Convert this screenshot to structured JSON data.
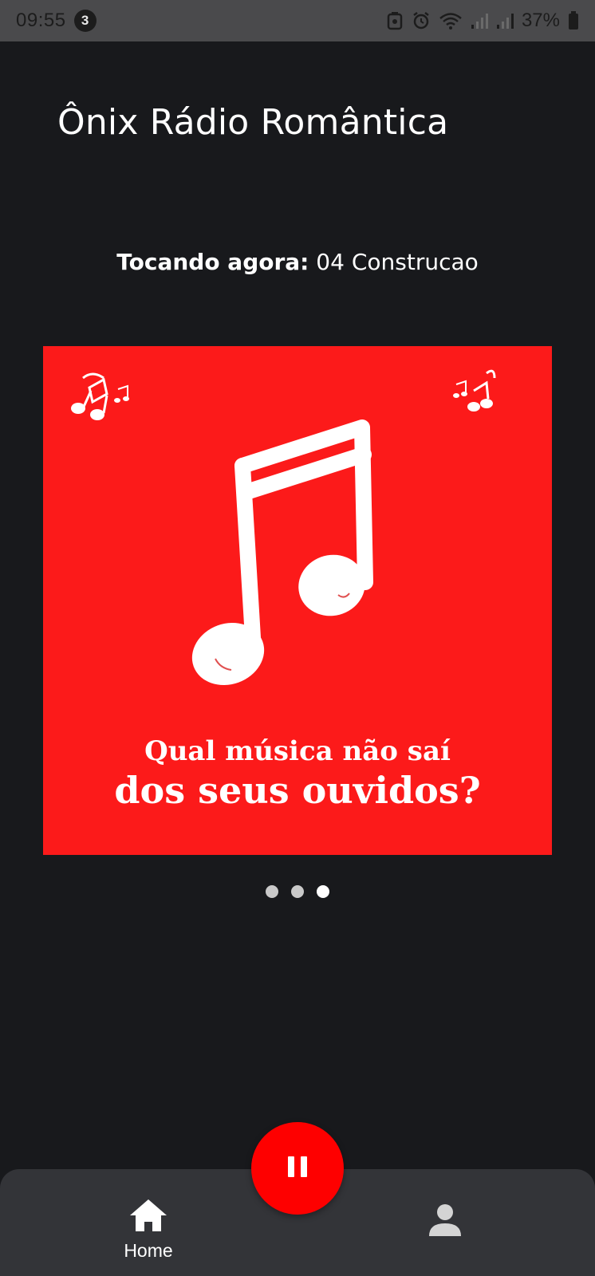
{
  "status_bar": {
    "time": "09:55",
    "notification_count": "3",
    "battery": "37%"
  },
  "header": {
    "title": "Ônix Rádio Romântica"
  },
  "now_playing": {
    "label": "Tocando agora:",
    "track": "04 Construcao"
  },
  "banner": {
    "line1": "Qual música não saí",
    "line2": "dos seus ouvidos?",
    "background": "#fc1a1a"
  },
  "carousel": {
    "total": 3,
    "active_index": 2
  },
  "player": {
    "state": "playing",
    "button_icon": "pause-icon",
    "accent": "#fe0000"
  },
  "bottom_nav": {
    "home_label": "Home"
  },
  "colors": {
    "background": "#18191c",
    "nav_background": "#333438",
    "status_bar": "#4a4a4c"
  }
}
